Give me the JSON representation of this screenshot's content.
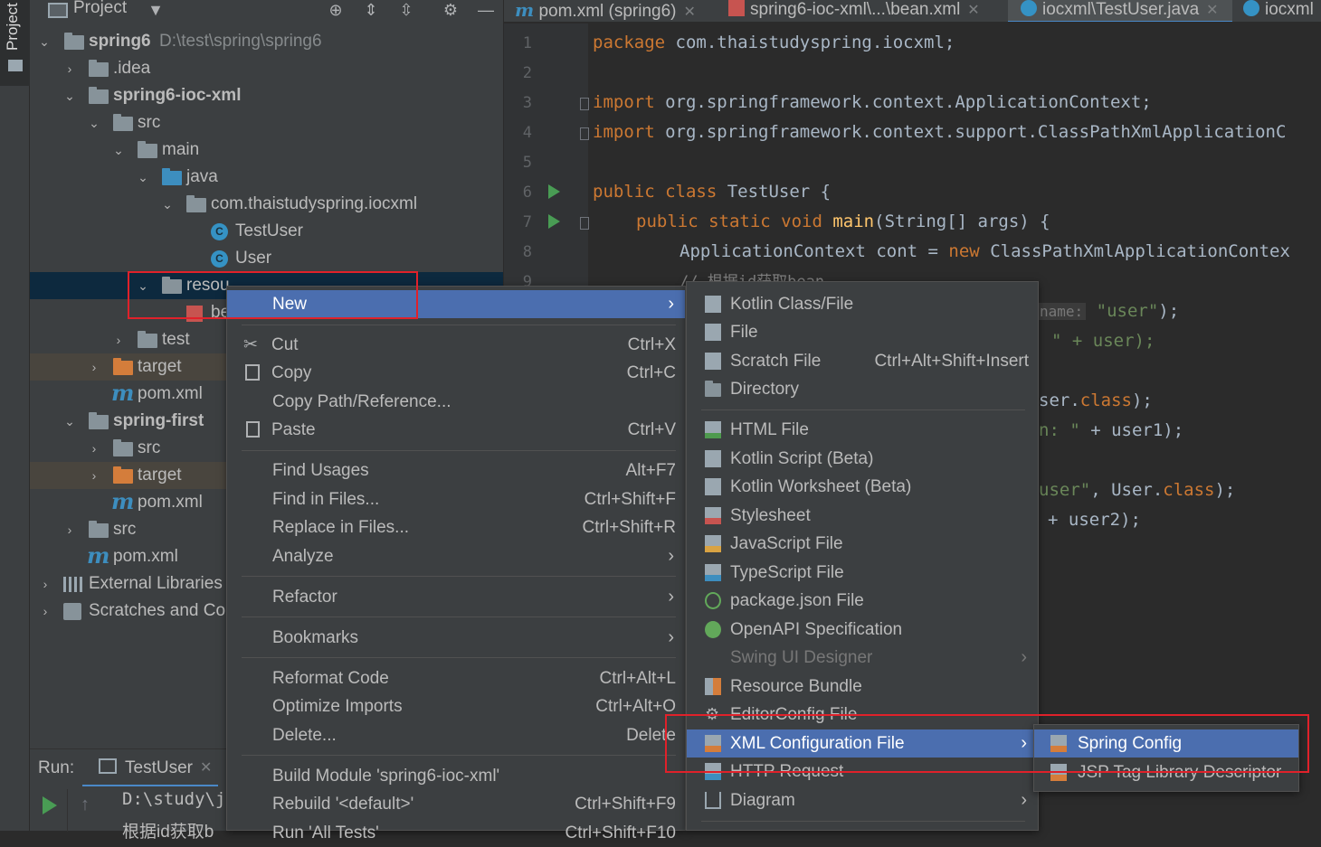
{
  "left_tool_window": {
    "label": "Project"
  },
  "project_panel": {
    "title": "Project",
    "tree": [
      {
        "label": "spring6",
        "path": "D:\\test\\spring\\spring6"
      },
      {
        "label": ".idea"
      },
      {
        "label": "spring6-ioc-xml"
      },
      {
        "label": "src"
      },
      {
        "label": "main"
      },
      {
        "label": "java"
      },
      {
        "label": "com.thaistudyspring.iocxml"
      },
      {
        "label": "TestUser"
      },
      {
        "label": "User"
      },
      {
        "label": "resou"
      },
      {
        "label": "be"
      },
      {
        "label": "test"
      },
      {
        "label": "target"
      },
      {
        "label": "pom.xml"
      },
      {
        "label": "spring-first"
      },
      {
        "label": "src"
      },
      {
        "label": "target"
      },
      {
        "label": "pom.xml"
      },
      {
        "label": "src"
      },
      {
        "label": "pom.xml"
      },
      {
        "label": "External Libraries"
      },
      {
        "label": "Scratches and Cor"
      }
    ]
  },
  "editor_tabs": [
    {
      "label": "pom.xml (spring6)"
    },
    {
      "label": "spring6-ioc-xml\\...\\bean.xml"
    },
    {
      "label": "iocxml\\TestUser.java"
    },
    {
      "label": "iocxml"
    }
  ],
  "code": {
    "line_numbers": [
      "1",
      "2",
      "3",
      "4",
      "5",
      "6",
      "7",
      "8",
      "9"
    ],
    "line1": {
      "kw": "package",
      "rest": " com.thaistudyspring.iocxml;"
    },
    "line3": {
      "kw": "import",
      "rest": " org.springframework.context.ApplicationContext;"
    },
    "line4": {
      "kw": "import",
      "rest": " org.springframework.context.support.ClassPathXmlApplicationC"
    },
    "line6": {
      "kw": "public class",
      "rest": " TestUser {"
    },
    "line7": {
      "kw": "public static void",
      "fn": "main",
      "rest": "(String[] args) {"
    },
    "line8": {
      "pre": "ApplicationContext cont = ",
      "kw": "new",
      "rest": " ClassPathXmlApplicationContex"
    },
    "line9": "// 根据id获取bean",
    "frag1": {
      "hint": "name:",
      "str": "\"user\"",
      "rest": ");"
    },
    "frag2": {
      "str": "\" + user);"
    },
    "frag3": {
      "pre": "ser.",
      "kw": "class",
      "rest": ");"
    },
    "frag4": {
      "str": "n: \"",
      "rest": " + user1);"
    },
    "frag5": {
      "str": "user\"",
      "pre": ", User.",
      "kw": "class",
      "rest": ");"
    },
    "frag6": {
      "rest": "+ user2);"
    }
  },
  "run_panel": {
    "label": "Run:",
    "tab": "TestUser",
    "console_line1": "D:\\study\\j",
    "console_line2": "根据id获取b"
  },
  "context_menu": {
    "items": [
      {
        "label": "New",
        "shortcut": "",
        "submenu": true
      },
      {
        "label": "Cut",
        "shortcut": "Ctrl+X"
      },
      {
        "label": "Copy",
        "shortcut": "Ctrl+C"
      },
      {
        "label": "Copy Path/Reference...",
        "shortcut": ""
      },
      {
        "label": "Paste",
        "shortcut": "Ctrl+V"
      },
      {
        "label": "Find Usages",
        "shortcut": "Alt+F7"
      },
      {
        "label": "Find in Files...",
        "shortcut": "Ctrl+Shift+F"
      },
      {
        "label": "Replace in Files...",
        "shortcut": "Ctrl+Shift+R"
      },
      {
        "label": "Analyze",
        "shortcut": "",
        "submenu": true
      },
      {
        "label": "Refactor",
        "shortcut": "",
        "submenu": true
      },
      {
        "label": "Bookmarks",
        "shortcut": "",
        "submenu": true
      },
      {
        "label": "Reformat Code",
        "shortcut": "Ctrl+Alt+L"
      },
      {
        "label": "Optimize Imports",
        "shortcut": "Ctrl+Alt+O"
      },
      {
        "label": "Delete...",
        "shortcut": "Delete"
      },
      {
        "label": "Build Module 'spring6-ioc-xml'",
        "shortcut": ""
      },
      {
        "label": "Rebuild '<default>'",
        "shortcut": "Ctrl+Shift+F9"
      },
      {
        "label": "Run 'All Tests'",
        "shortcut": "Ctrl+Shift+F10"
      }
    ]
  },
  "new_submenu": {
    "items": [
      {
        "label": "Kotlin Class/File",
        "shortcut": ""
      },
      {
        "label": "File",
        "shortcut": ""
      },
      {
        "label": "Scratch File",
        "shortcut": "Ctrl+Alt+Shift+Insert"
      },
      {
        "label": "Directory",
        "shortcut": ""
      },
      {
        "label": "HTML File",
        "shortcut": ""
      },
      {
        "label": "Kotlin Script (Beta)",
        "shortcut": ""
      },
      {
        "label": "Kotlin Worksheet (Beta)",
        "shortcut": ""
      },
      {
        "label": "Stylesheet",
        "shortcut": ""
      },
      {
        "label": "JavaScript File",
        "shortcut": ""
      },
      {
        "label": "TypeScript File",
        "shortcut": ""
      },
      {
        "label": "package.json File",
        "shortcut": ""
      },
      {
        "label": "OpenAPI Specification",
        "shortcut": ""
      },
      {
        "label": "Swing UI Designer",
        "shortcut": "",
        "disabled": true
      },
      {
        "label": "Resource Bundle",
        "shortcut": ""
      },
      {
        "label": "EditorConfig File",
        "shortcut": ""
      },
      {
        "label": "XML Configuration File",
        "shortcut": "",
        "submenu": true
      },
      {
        "label": "HTTP Request",
        "shortcut": ""
      },
      {
        "label": "Diagram",
        "shortcut": "",
        "submenu": true
      }
    ]
  },
  "xml_submenu": {
    "items": [
      {
        "label": "Spring Config"
      },
      {
        "label": "JSP Tag Library Descriptor"
      }
    ]
  },
  "colors": {
    "highlight": "#4b6eaf",
    "annotation_box": "#e0212a",
    "panel_bg": "#3c3f41",
    "editor_bg": "#2b2b2b"
  }
}
